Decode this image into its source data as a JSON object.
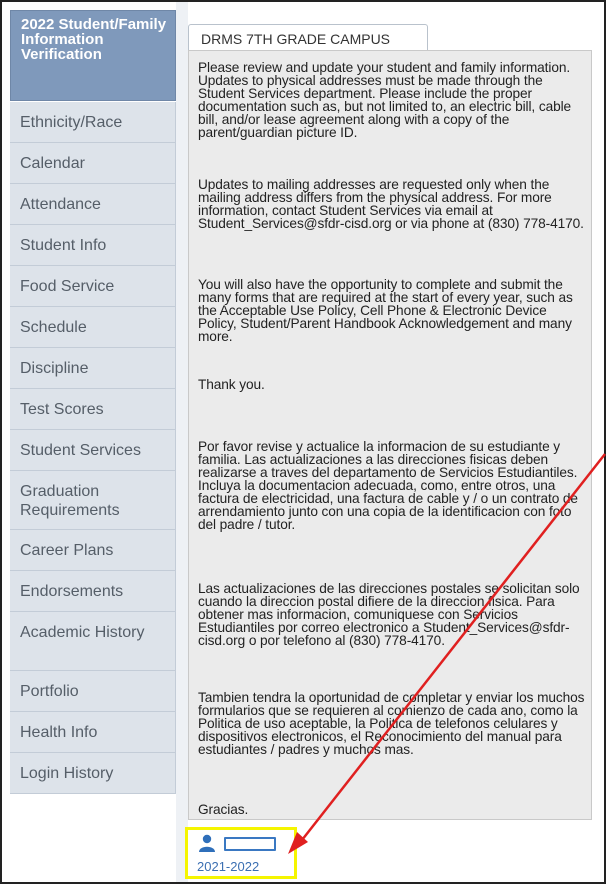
{
  "sidebar": {
    "header": "2022 Student/Family Information Verification",
    "items": [
      {
        "label": "Ethnicity/Race"
      },
      {
        "label": "Calendar"
      },
      {
        "label": "Attendance"
      },
      {
        "label": "Student Info"
      },
      {
        "label": "Food Service"
      },
      {
        "label": "Schedule"
      },
      {
        "label": "Discipline"
      },
      {
        "label": "Test Scores"
      },
      {
        "label": "Student Services"
      },
      {
        "label": "Graduation Requirements"
      },
      {
        "label": "Career Plans"
      },
      {
        "label": "Endorsements"
      },
      {
        "label": "Academic History"
      },
      {
        "label": "Portfolio"
      },
      {
        "label": "Health Info"
      },
      {
        "label": "Login History"
      }
    ]
  },
  "tab": {
    "label": "DRMS 7TH GRADE CAMPUS"
  },
  "message": {
    "p1": "Please review and update your student and family information. Updates to physical addresses must be made through the Student Services department. Please include the proper documentation such as, but not limited to, an electric bill, cable bill, and/or lease agreement along with a copy of the parent/guardian picture ID.",
    "p2": "Updates to mailing addresses are requested only when the mailing address differs from the physical address. For more information, contact Student Services via email at Student_Services@sfdr-cisd.org or via phone at (830) 778-4170.",
    "p3": "You will also have the opportunity to complete and submit the many forms that are required at the start of every year, such as the Acceptable Use Policy, Cell Phone & Electronic Device Policy, Student/Parent Handbook Acknowledgement and many more.",
    "p4": "Thank you.",
    "p5": "Por favor revise y actualice la informacion de su estudiante y familia. Las actualizaciones a las direcciones fisicas deben realizarse a traves del departamento de Servicios Estudiantiles. Incluya la documentacion adecuada, como, entre otros, una factura de electricidad, una factura de cable y / o un contrato de arrendamiento junto con una copia de la identificacion con foto del padre / tutor.",
    "p6": "Las actualizaciones de las direcciones postales se solicitan solo cuando la direccion postal difiere de la direccion fisica. Para obtener mas informacion, comuniquese con Servicios Estudiantiles por correo electronico a Student_Services@sfdr-cisd.org o por telefono al (830) 778-4170.",
    "p7": "Tambien tendra la oportunidad de completar y enviar los muchos formularios que se requieren al comienzo de cada ano, como la Politica de uso aceptable, la Politica de telefonos celulares y dispositivos electronicos, el Reconocimiento del manual para estudiantes / padres y muchos mas.",
    "p8": "Gracias."
  },
  "footer": {
    "year": "2021-2022",
    "icon": "user-icon",
    "highlight_color": "#f5f500",
    "arrow_color": "#e02020"
  }
}
